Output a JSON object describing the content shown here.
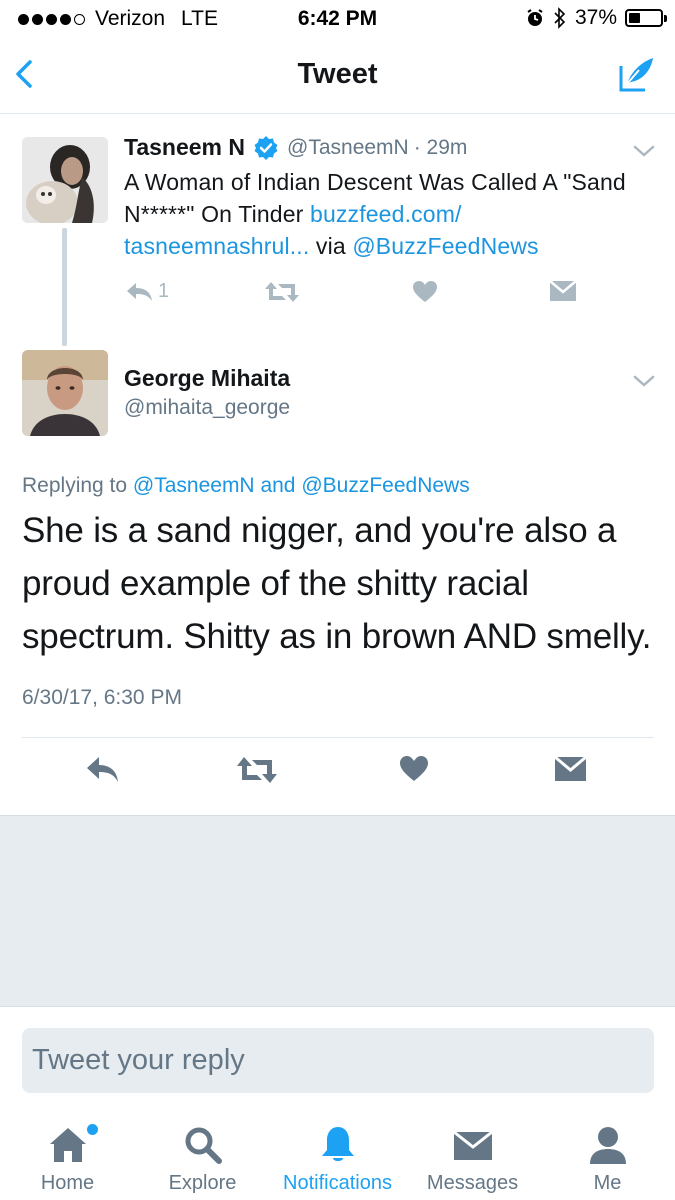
{
  "status_bar": {
    "carrier": "Verizon",
    "network": "LTE",
    "time": "6:42 PM",
    "battery": "37%",
    "battery_level": 0.37,
    "signal_bars": 4,
    "signal_max": 5
  },
  "nav": {
    "title": "Tweet",
    "back_icon": "chevron-left-icon",
    "compose_icon": "compose-quill-icon"
  },
  "parent_tweet": {
    "name": "Tasneem N",
    "handle": "@TasneemN",
    "time": "· 29m",
    "text": "A Woman of Indian Descent Was Called A \"Sand N*****\" On Tinder ",
    "link_text": "buzzfeed.com/ tasneemnashrul...",
    "via_text": " via ",
    "via_handle": "@BuzzFeedNews",
    "reply_count": "1"
  },
  "main_tweet": {
    "name": "George Mihaita",
    "handle": "@mihaita_george",
    "replying_prefix": "Replying to ",
    "replying_user1": "@TasneemN",
    "replying_and": " and ",
    "replying_user2": "@BuzzFeedNews",
    "text": "She is a sand nigger, and you're also a proud example of the shitty racial spectrum. Shitty as in brown AND smelly.",
    "timestamp": "6/30/17, 6:30 PM"
  },
  "reply_box": {
    "placeholder": "Tweet your reply"
  },
  "tabs": [
    {
      "label": "Home",
      "icon": "home-icon",
      "active": false,
      "has_dot": true
    },
    {
      "label": "Explore",
      "icon": "search-icon",
      "active": false
    },
    {
      "label": "Notifications",
      "icon": "bell-icon",
      "active": true
    },
    {
      "label": "Messages",
      "icon": "envelope-icon",
      "active": false
    },
    {
      "label": "Me",
      "icon": "person-icon",
      "active": false
    }
  ],
  "colors": {
    "accent": "#1da1f2",
    "link": "#1b95e0",
    "muted": "#657786",
    "action_gray": "#aab8c2",
    "background_gray": "#e6ecf0"
  }
}
